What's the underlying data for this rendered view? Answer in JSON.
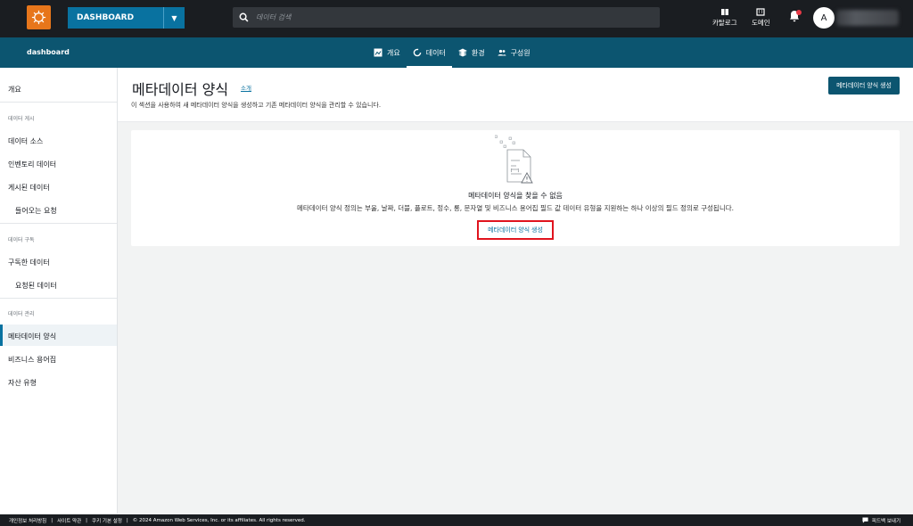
{
  "topbar": {
    "project_label": "DASHBOARD",
    "search_placeholder": "데이터 검색",
    "catalog_label": "카탈로그",
    "domain_label": "도메인",
    "avatar_initial": "A",
    "colors": {
      "background": "#1a1d21",
      "project": "#0972a0",
      "logo": "#e7761b",
      "notification": "#e63946"
    }
  },
  "navbar": {
    "domain_name": "dashboard",
    "tabs": [
      {
        "label": "개요",
        "icon": "overview-icon"
      },
      {
        "label": "데이터",
        "icon": "data-icon",
        "active": true
      },
      {
        "label": "환경",
        "icon": "environment-icon"
      },
      {
        "label": "구성원",
        "icon": "members-icon"
      }
    ],
    "color": "#0c5570"
  },
  "sidebar": {
    "overview": "개요",
    "group_publish": "데이터 게시",
    "data_sources": "데이터 소스",
    "inventory": "인벤토리 데이터",
    "published": "게시된 데이터",
    "incoming_requests": "들어오는 요청",
    "group_subscribe": "데이터 구독",
    "subscribed": "구독한 데이터",
    "requested": "요청된 데이터",
    "group_manage": "데이터 관리",
    "metadata_forms": "메타데이터 양식",
    "glossaries": "비즈니스 용어집",
    "asset_types": "자산 유형",
    "active_item": "메타데이터 양식"
  },
  "header": {
    "title": "메타데이터 양식",
    "info_link": "소개",
    "description": "이 섹션을 사용하여 새 메타데이터 양식을 생성하고 기존 메타데이터 양식을 관리할 수 있습니다.",
    "create_button": "메타데이터 양식 생성"
  },
  "empty_state": {
    "title": "메타데이터 양식을 찾을 수 없음",
    "description": "메타데이터 양식 정의는 부울, 날짜, 더블, 플로트, 정수, 롱, 문자열 및 비즈니스 용어집 필드 값 데이터 유형을 지원하는 하나 이상의 필드 정의로 구성됩니다.",
    "create_button": "메타데이터 양식 생성",
    "highlight_color": "#e0141e"
  },
  "footer": {
    "privacy": "개인정보 처리방침",
    "site_terms": "사이트 약관",
    "cookie_settings": "쿠키 기본 설정",
    "copyright": "© 2024 Amazon Web Services, Inc. or its affiliates. All rights reserved.",
    "separator": "|",
    "feedback": "피드백 보내기"
  }
}
